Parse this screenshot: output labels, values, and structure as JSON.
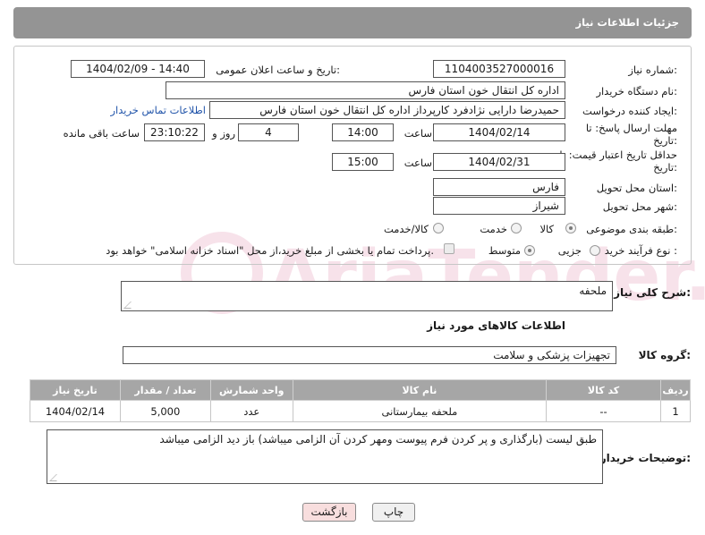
{
  "header": {
    "title": "جزئیات اطلاعات نیاز"
  },
  "form": {
    "need_number": {
      "label": "شماره نیاز:",
      "value": "1104003527000016"
    },
    "announce_datetime": {
      "label": "تاریخ و ساعت اعلان عمومی:",
      "value": "1404/02/09 - 14:40"
    },
    "buyer_org": {
      "label": "نام دستگاه خریدار:",
      "value": "اداره کل انتقال خون استان فارس"
    },
    "requester": {
      "label": "ایجاد کننده درخواست:",
      "value": "حمیدرضا دارایی نژادفرد کارپرداز اداره کل انتقال خون استان فارس",
      "contact_link": "اطلاعات تماس خریدار"
    },
    "reply_deadline": {
      "label": "مهلت ارسال پاسخ: تا تاریخ:",
      "date": "1404/02/14",
      "time_label": "ساعت",
      "time": "14:00",
      "days": "4",
      "days_label": "روز و",
      "remaining": "23:10:22",
      "remaining_label": "ساعت باقی مانده"
    },
    "price_validity": {
      "label": "حداقل تاریخ اعتبار قیمت: تا تاریخ:",
      "date": "1404/02/31",
      "time_label": "ساعت",
      "time": "15:00"
    },
    "delivery_province": {
      "label": "استان محل تحویل:",
      "value": "فارس"
    },
    "delivery_city": {
      "label": "شهر محل تحویل:",
      "value": "شیراز"
    },
    "category": {
      "label": "طبقه بندی موضوعی:",
      "options": [
        "کالا",
        "خدمت",
        "کالا/خدمت"
      ],
      "selected": "کالا"
    },
    "purchase_process": {
      "label": "نوع فرآیند خرید :",
      "options": [
        "جزیی",
        "متوسط"
      ],
      "selected": "متوسط",
      "payment_note": "پرداخت تمام یا بخشی از مبلغ خرید،از محل \"اسناد خزانه اسلامی\" خواهد بود."
    }
  },
  "summary": {
    "label": "شرح کلی نیاز:",
    "value": "ملحفه"
  },
  "goods_section": {
    "title": "اطلاعات کالاهای مورد نیاز",
    "group_label": "گروه کالا:",
    "group_value": "تجهیزات پزشکی و سلامت",
    "columns": [
      "ردیف",
      "کد کالا",
      "نام کالا",
      "واحد شمارش",
      "تعداد / مقدار",
      "تاریخ نیاز"
    ],
    "rows": [
      {
        "row": "1",
        "code": "--",
        "name": "ملحفه بیمارستانی",
        "unit": "عدد",
        "qty": "5,000",
        "date": "1404/02/14"
      }
    ]
  },
  "buyer_notes": {
    "label": "توضیحات خریدار:",
    "value": "طبق لیست (بارگذاری و پر کردن فرم پیوست ومهر کردن آن الزامی میباشد) باز دید الزامی میباشد"
  },
  "buttons": {
    "print": "چاپ",
    "back": "بازگشت"
  },
  "watermark": {
    "text": "AriaTender.neT"
  },
  "colors": {
    "header_bg": "#949494",
    "table_header_bg": "#a6a6a6",
    "back_button_bg": "#f8dede",
    "link": "#2255aa"
  }
}
